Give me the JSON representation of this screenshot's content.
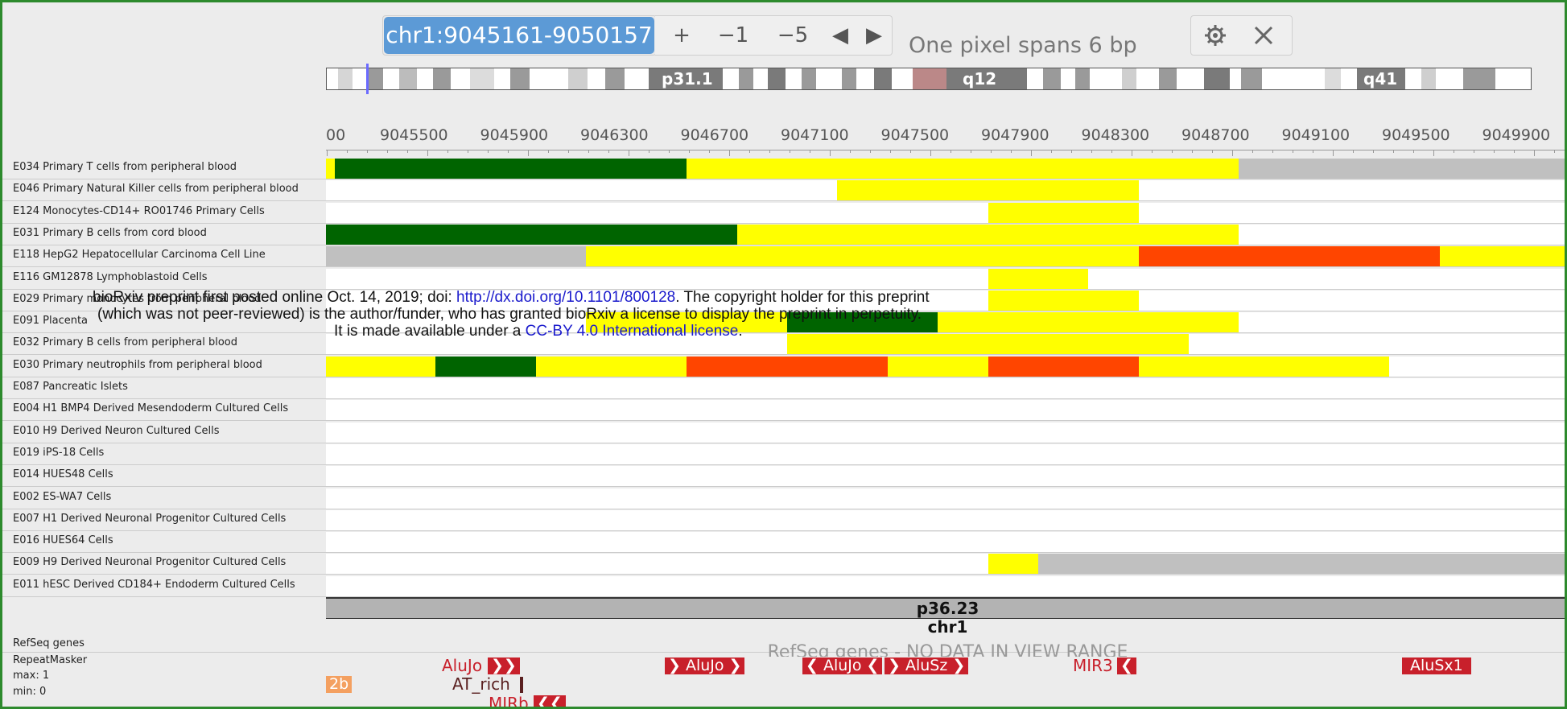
{
  "toolbar": {
    "locus": "chr1:9045161-9050157",
    "zoom_in": "+",
    "zoom_out_1": "−1",
    "zoom_out_5": "−5",
    "pan_left": "◀",
    "pan_right": "▶",
    "pixel_note": "One pixel spans 6 bp",
    "settings_icon": "gear-icon",
    "close_icon": "close-icon"
  },
  "ideogram": {
    "bands": [
      "p31.1",
      "q12",
      "q41"
    ]
  },
  "ruler": {
    "ticks": [
      "00",
      "9045500",
      "9045900",
      "9046300",
      "9046700",
      "9047100",
      "9047500",
      "9047900",
      "9048300",
      "9048700",
      "9049100",
      "9049500",
      "9049900"
    ]
  },
  "colors": {
    "dark_green": "#006400",
    "yellow": "#ffff00",
    "orange_red": "#ff4500",
    "gray": "#c0c0c0",
    "accent_blue": "#5c9ad6"
  },
  "tracks": [
    {
      "label": "E034 Primary T cells from peripheral blood",
      "segments": [
        {
          "c": "yellow",
          "s": 0,
          "e": 0.007
        },
        {
          "c": "dark_green",
          "s": 0.007,
          "e": 0.29
        },
        {
          "c": "yellow",
          "s": 0.29,
          "e": 0.734
        },
        {
          "c": "gray",
          "s": 0.734,
          "e": 1
        }
      ]
    },
    {
      "label": "E046 Primary Natural Killer cells from peripheral blood",
      "segments": [
        {
          "c": "yellow",
          "s": 0.411,
          "e": 0.654
        }
      ]
    },
    {
      "label": "E124 Monocytes-CD14+ RO01746 Primary Cells",
      "segments": [
        {
          "c": "yellow",
          "s": 0.533,
          "e": 0.654
        }
      ]
    },
    {
      "label": "E031 Primary B cells from cord blood",
      "segments": [
        {
          "c": "dark_green",
          "s": 0,
          "e": 0.331
        },
        {
          "c": "yellow",
          "s": 0.331,
          "e": 0.734
        }
      ]
    },
    {
      "label": "E118 HepG2 Hepatocellular Carcinoma Cell Line",
      "segments": [
        {
          "c": "gray",
          "s": 0,
          "e": 0.209
        },
        {
          "c": "yellow",
          "s": 0.209,
          "e": 0.654
        },
        {
          "c": "orange_red",
          "s": 0.654,
          "e": 0.896
        },
        {
          "c": "yellow",
          "s": 0.896,
          "e": 1
        }
      ]
    },
    {
      "label": "E116 GM12878 Lymphoblastoid Cells",
      "segments": [
        {
          "c": "yellow",
          "s": 0.533,
          "e": 0.613
        }
      ]
    },
    {
      "label": "E029 Primary monocytes from peripheral blood",
      "segments": [
        {
          "c": "yellow",
          "s": 0.533,
          "e": 0.654
        }
      ]
    },
    {
      "label": "E091 Placenta",
      "segments": [
        {
          "c": "yellow",
          "s": 0.209,
          "e": 0.371
        },
        {
          "c": "dark_green",
          "s": 0.371,
          "e": 0.492
        },
        {
          "c": "yellow",
          "s": 0.492,
          "e": 0.734
        }
      ]
    },
    {
      "label": "E032 Primary B cells from peripheral blood",
      "segments": [
        {
          "c": "yellow",
          "s": 0.371,
          "e": 0.694
        }
      ]
    },
    {
      "label": "E030 Primary neutrophils from peripheral blood",
      "segments": [
        {
          "c": "yellow",
          "s": 0,
          "e": 0.088
        },
        {
          "c": "dark_green",
          "s": 0.088,
          "e": 0.169
        },
        {
          "c": "yellow",
          "s": 0.169,
          "e": 0.29
        },
        {
          "c": "orange_red",
          "s": 0.29,
          "e": 0.452
        },
        {
          "c": "yellow",
          "s": 0.452,
          "e": 0.533
        },
        {
          "c": "orange_red",
          "s": 0.533,
          "e": 0.654
        },
        {
          "c": "yellow",
          "s": 0.654,
          "e": 0.855
        }
      ]
    },
    {
      "label": "E087 Pancreatic Islets",
      "segments": []
    },
    {
      "label": "E004 H1 BMP4 Derived Mesendoderm Cultured Cells",
      "segments": []
    },
    {
      "label": "E010 H9 Derived Neuron Cultured Cells",
      "segments": []
    },
    {
      "label": "E019 iPS-18 Cells",
      "segments": []
    },
    {
      "label": "E014 HUES48 Cells",
      "segments": []
    },
    {
      "label": "E002 ES-WA7 Cells",
      "segments": []
    },
    {
      "label": "E007 H1 Derived Neuronal Progenitor Cultured Cells",
      "segments": []
    },
    {
      "label": "E016 HUES64 Cells",
      "segments": []
    },
    {
      "label": "E009 H9 Derived Neuronal Progenitor Cultured Cells",
      "segments": [
        {
          "c": "yellow",
          "s": 0.533,
          "e": 0.573
        },
        {
          "c": "gray",
          "s": 0.573,
          "e": 1
        }
      ]
    },
    {
      "label": "E011 hESC Derived CD184+ Endoderm Cultured Cells",
      "segments": []
    }
  ],
  "chromosome": {
    "band": "p36.23",
    "name": "chr1"
  },
  "refseq": {
    "label": "RefSeq genes",
    "empty_message": "RefSeq genes - NO DATA IN VIEW RANGE"
  },
  "repeatmasker": {
    "label": "RepeatMasker",
    "max": "max: 1",
    "min": "min: 0",
    "items": {
      "alujo1_text": "AluJo",
      "alujo1_arrows": "❯❯",
      "alujo2": "❯ AluJo ❯",
      "alujo3": "❮ AluJo ❮",
      "alusz": "❯ AluSz ❯",
      "mir3_text": "MIR3",
      "mir3_arrow": "❮",
      "alusx1": "AluSx1",
      "left_2b": "2b",
      "at_rich": "AT_rich",
      "mirb_text": "MIRb",
      "mirb_arrows": "❮❮"
    }
  },
  "watermark": {
    "line1_pre": "bioRxiv preprint first posted online Oct. 14, 2019; doi: ",
    "line1_link": "http://dx.doi.org/10.1101/800128",
    "line1_post": ". The copyright holder for this preprint",
    "line2": "(which was not peer-reviewed) is the author/funder, who has granted bioRxiv a license to display the preprint in perpetuity.",
    "line3_pre": "It is made available under a ",
    "line3_link": "CC-BY 4.0 International license",
    "line3_post": "."
  }
}
